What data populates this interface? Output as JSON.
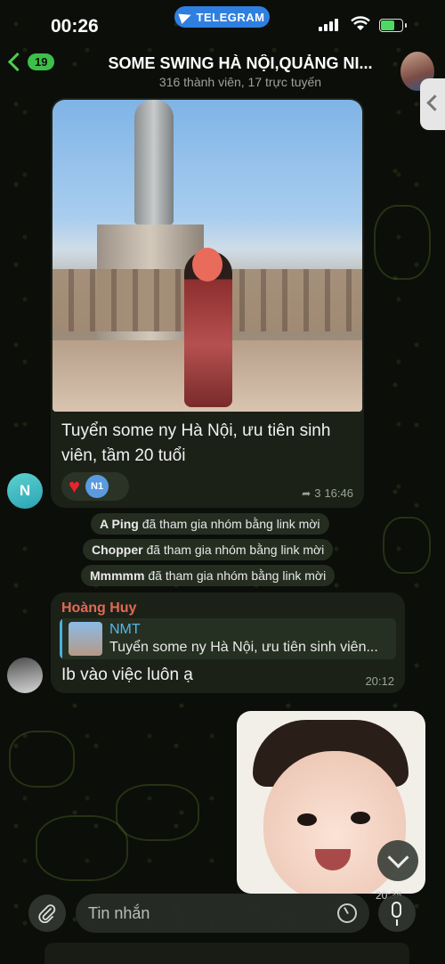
{
  "status_bar": {
    "time": "00:26",
    "app_pill": "TELEGRAM"
  },
  "header": {
    "back_count": "19",
    "title": "SOME SWING HÀ NỘI,QUẢNG NI...",
    "subtitle": "316 thành viên, 17 trực tuyến"
  },
  "messages": {
    "m1": {
      "caption": "Tuyển some ny Hà Nội, ưu tiên sinh viên, tầm 20 tuổi",
      "reaction_emoji": "♥",
      "reaction_avatar": "N1",
      "replies": "3",
      "time": "16:46",
      "sender_initial": "N"
    },
    "service": [
      {
        "name": "A Ping",
        "text": "đã tham gia nhóm bằng link mời"
      },
      {
        "name": "Chopper",
        "text": "đã tham gia nhóm bằng link mời"
      },
      {
        "name": "Mmmmm",
        "text": "đã tham gia nhóm bằng link mời"
      }
    ],
    "m2": {
      "sender": "Hoàng Huy",
      "quote_name": "NMT",
      "quote_text": "Tuyển some ny Hà Nội, ưu tiên sinh viên...",
      "text": "Ib vào việc luôn ạ",
      "time": "20:12"
    },
    "video": {
      "time": "20:36"
    }
  },
  "composer": {
    "placeholder": "Tin nhắn"
  },
  "colors": {
    "accent_green": "#3dbf4a",
    "telegram_blue": "#2f7fe0",
    "sender_name": "#e06a55",
    "quote_name": "#58b7e8"
  },
  "icons": [
    "telegram-plane-icon",
    "signal-icon",
    "wifi-icon",
    "battery-icon",
    "back-chevron-icon",
    "side-panel-chevron-icon",
    "heart-icon",
    "reply-arrow-icon",
    "attach-paperclip-icon",
    "sticker-icon",
    "mic-icon",
    "scroll-down-chevron-icon"
  ]
}
